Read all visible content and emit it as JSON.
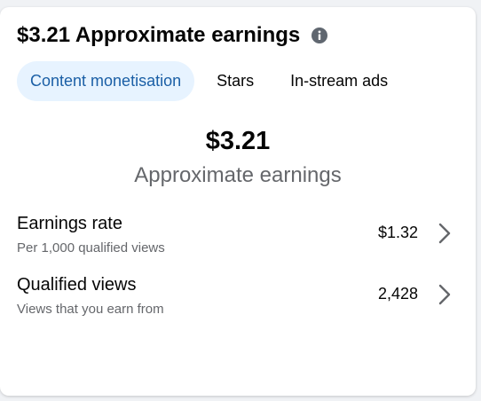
{
  "header": {
    "title": "$3.21 Approximate earnings",
    "info_icon": "info-icon"
  },
  "tabs": [
    {
      "label": "Content monetisation",
      "active": true
    },
    {
      "label": "Stars",
      "active": false
    },
    {
      "label": "In-stream ads",
      "active": false
    }
  ],
  "summary": {
    "amount": "$3.21",
    "label": "Approximate earnings"
  },
  "rows": [
    {
      "title": "Earnings rate",
      "subtitle": "Per 1,000 qualified views",
      "value": "$1.32",
      "icon": "chevron-right-icon"
    },
    {
      "title": "Qualified views",
      "subtitle": "Views that you earn from",
      "value": "2,428",
      "icon": "chevron-right-icon"
    }
  ],
  "colors": {
    "active_tab_bg": "#e7f3ff",
    "active_tab_text": "#1b5fa6",
    "primary_text": "#050505",
    "secondary_text": "#65676b"
  }
}
